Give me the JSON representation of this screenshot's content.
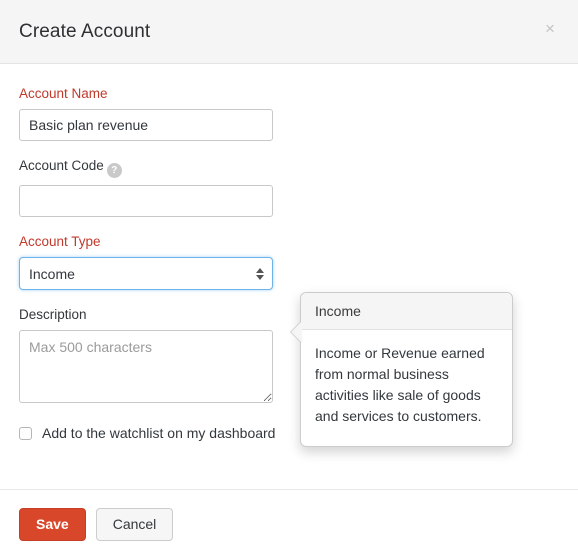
{
  "dialog": {
    "title": "Create Account",
    "close_label": "×"
  },
  "form": {
    "account_name": {
      "label": "Account Name",
      "value": "Basic plan revenue",
      "placeholder": ""
    },
    "account_code": {
      "label": "Account Code",
      "help_glyph": "?",
      "value": "",
      "placeholder": ""
    },
    "account_type": {
      "label": "Account Type",
      "selected": "Income",
      "options": [
        "Income"
      ]
    },
    "description": {
      "label": "Description",
      "value": "",
      "placeholder": "Max 500 characters"
    },
    "watchlist": {
      "label": "Add to the watchlist on my dashboard",
      "checked": false
    }
  },
  "tooltip": {
    "header": "Income",
    "body": "Income or Revenue earned from normal business activities like sale of goods and services to customers."
  },
  "footer": {
    "save_label": "Save",
    "cancel_label": "Cancel"
  },
  "colors": {
    "required_label": "#c0392b",
    "save_button": "#d9472b",
    "header_background": "#f5f5f5",
    "focus_border": "#6fb3e8"
  }
}
